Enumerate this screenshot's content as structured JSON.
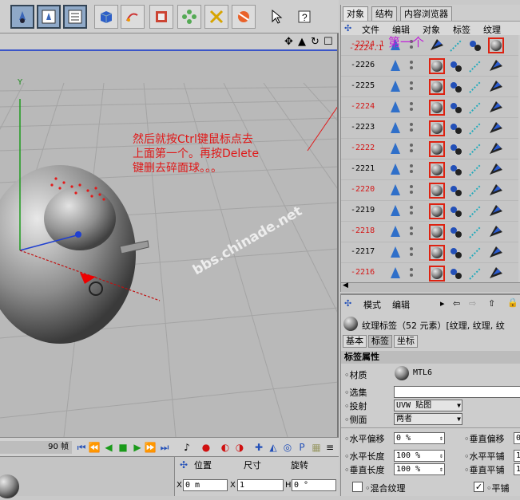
{
  "toolbar": {
    "icons": [
      "render-view-icon",
      "render-picture-icon",
      "render-settings-icon",
      "cube-icon",
      "spline-pen-icon",
      "nurbs-icon",
      "array-icon",
      "deformer-icon",
      "scene-icon",
      "select-icon",
      "help-icon"
    ]
  },
  "viewport": {
    "frame_label": "90 帧",
    "axis_y": "Y"
  },
  "annotation": {
    "line1": "然后就按Ctrl键鼠标点去",
    "line2": "上面第一个。再按Delete",
    "line3": "键删去碎面球。。。",
    "first": "第一个"
  },
  "watermark": "bbs.chinade.net",
  "coords": {
    "headers": [
      "位置",
      "尺寸",
      "旋转"
    ],
    "x_pos": "0 m",
    "x_size": "1",
    "h_rot": "0 °",
    "axis_x": "X",
    "axis_x2": "X",
    "axis_h": "H"
  },
  "object_manager": {
    "tabs": [
      "对象",
      "结构",
      "内容浏览器"
    ],
    "menu": [
      "文件",
      "编辑",
      "对象",
      "标签",
      "纹理"
    ],
    "rows": [
      {
        "name": "-2224.1",
        "red": true
      },
      {
        "name": "-2226",
        "red": false
      },
      {
        "name": "-2225",
        "red": false
      },
      {
        "name": "-2224",
        "red": true
      },
      {
        "name": "-2223",
        "red": false
      },
      {
        "name": "-2222",
        "red": true
      },
      {
        "name": "-2221",
        "red": false
      },
      {
        "name": "-2220",
        "red": true
      },
      {
        "name": "-2219",
        "red": false
      },
      {
        "name": "-2218",
        "red": true
      },
      {
        "name": "-2217",
        "red": false
      },
      {
        "name": "-2216",
        "red": true
      }
    ]
  },
  "attribute_manager": {
    "menu": [
      "模式",
      "编辑"
    ],
    "title": "纹理标签（52 元素）[纹理, 纹理, 纹",
    "tabs": [
      "基本",
      "标签",
      "坐标"
    ],
    "section": "标签属性",
    "material_label": "材质",
    "material_value": "MTL6",
    "selection_label": "选集",
    "selection_value": "",
    "projection_label": "投射",
    "projection_value": "UVW 贴图",
    "side_label": "侧面",
    "side_value": "两者",
    "offset_x_label": "水平偏移",
    "offset_x_value": "0 %",
    "offset_y_label": "垂直偏移",
    "offset_y_value": "0",
    "length_x_label": "水平长度",
    "length_x_value": "100 %",
    "tile_x_label": "水平平铺",
    "tile_x_value": "1",
    "length_y_label": "垂直长度",
    "length_y_value": "100 %",
    "tile_y_label": "垂直平铺",
    "tile_y_value": "1",
    "mix_label": "混合纹理",
    "mix_checked": false,
    "tile_label": "平铺",
    "tile_checked": true
  }
}
